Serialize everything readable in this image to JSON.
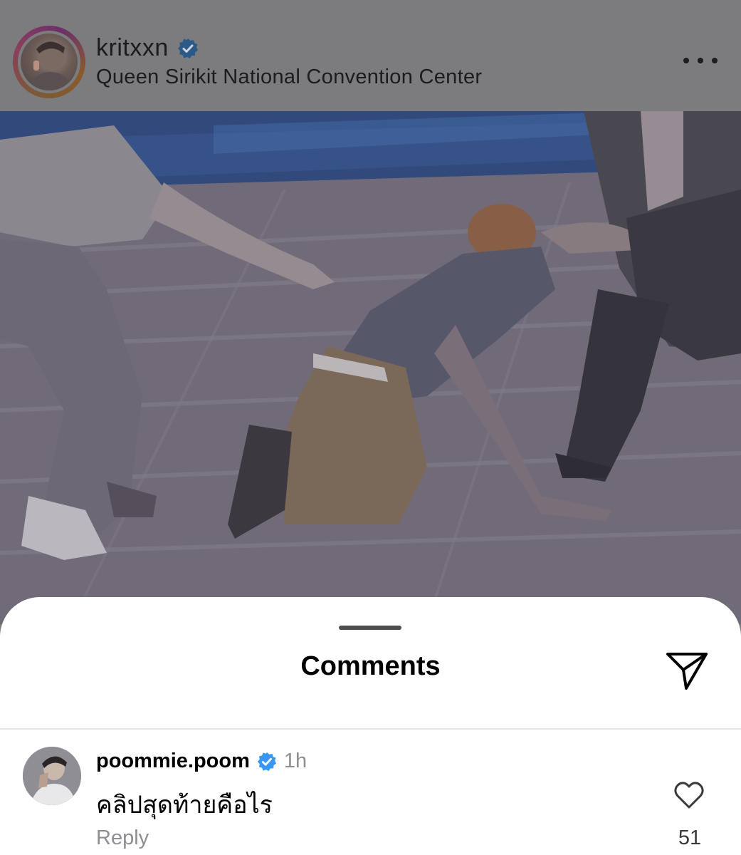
{
  "post": {
    "username": "kritxxn",
    "verified": true,
    "location": "Queen Sirikit National Convention Center",
    "more_icon": "ellipsis-icon"
  },
  "photo": {
    "icon": "stage-performance-photo"
  },
  "comments_sheet": {
    "title": "Comments",
    "share_icon": "send-paper-plane-icon"
  },
  "comments": [
    {
      "username": "poommie.poom",
      "verified": true,
      "time": "1h",
      "text": "คลิปสุดท้ายคือไร",
      "reply_label": "Reply",
      "likes": "51"
    }
  ],
  "colors": {
    "verified_badge": "#3897f0",
    "dim_overlay": "#7c7c7f",
    "sheet_bg": "#ffffff",
    "secondary_text": "#8e8e93"
  }
}
